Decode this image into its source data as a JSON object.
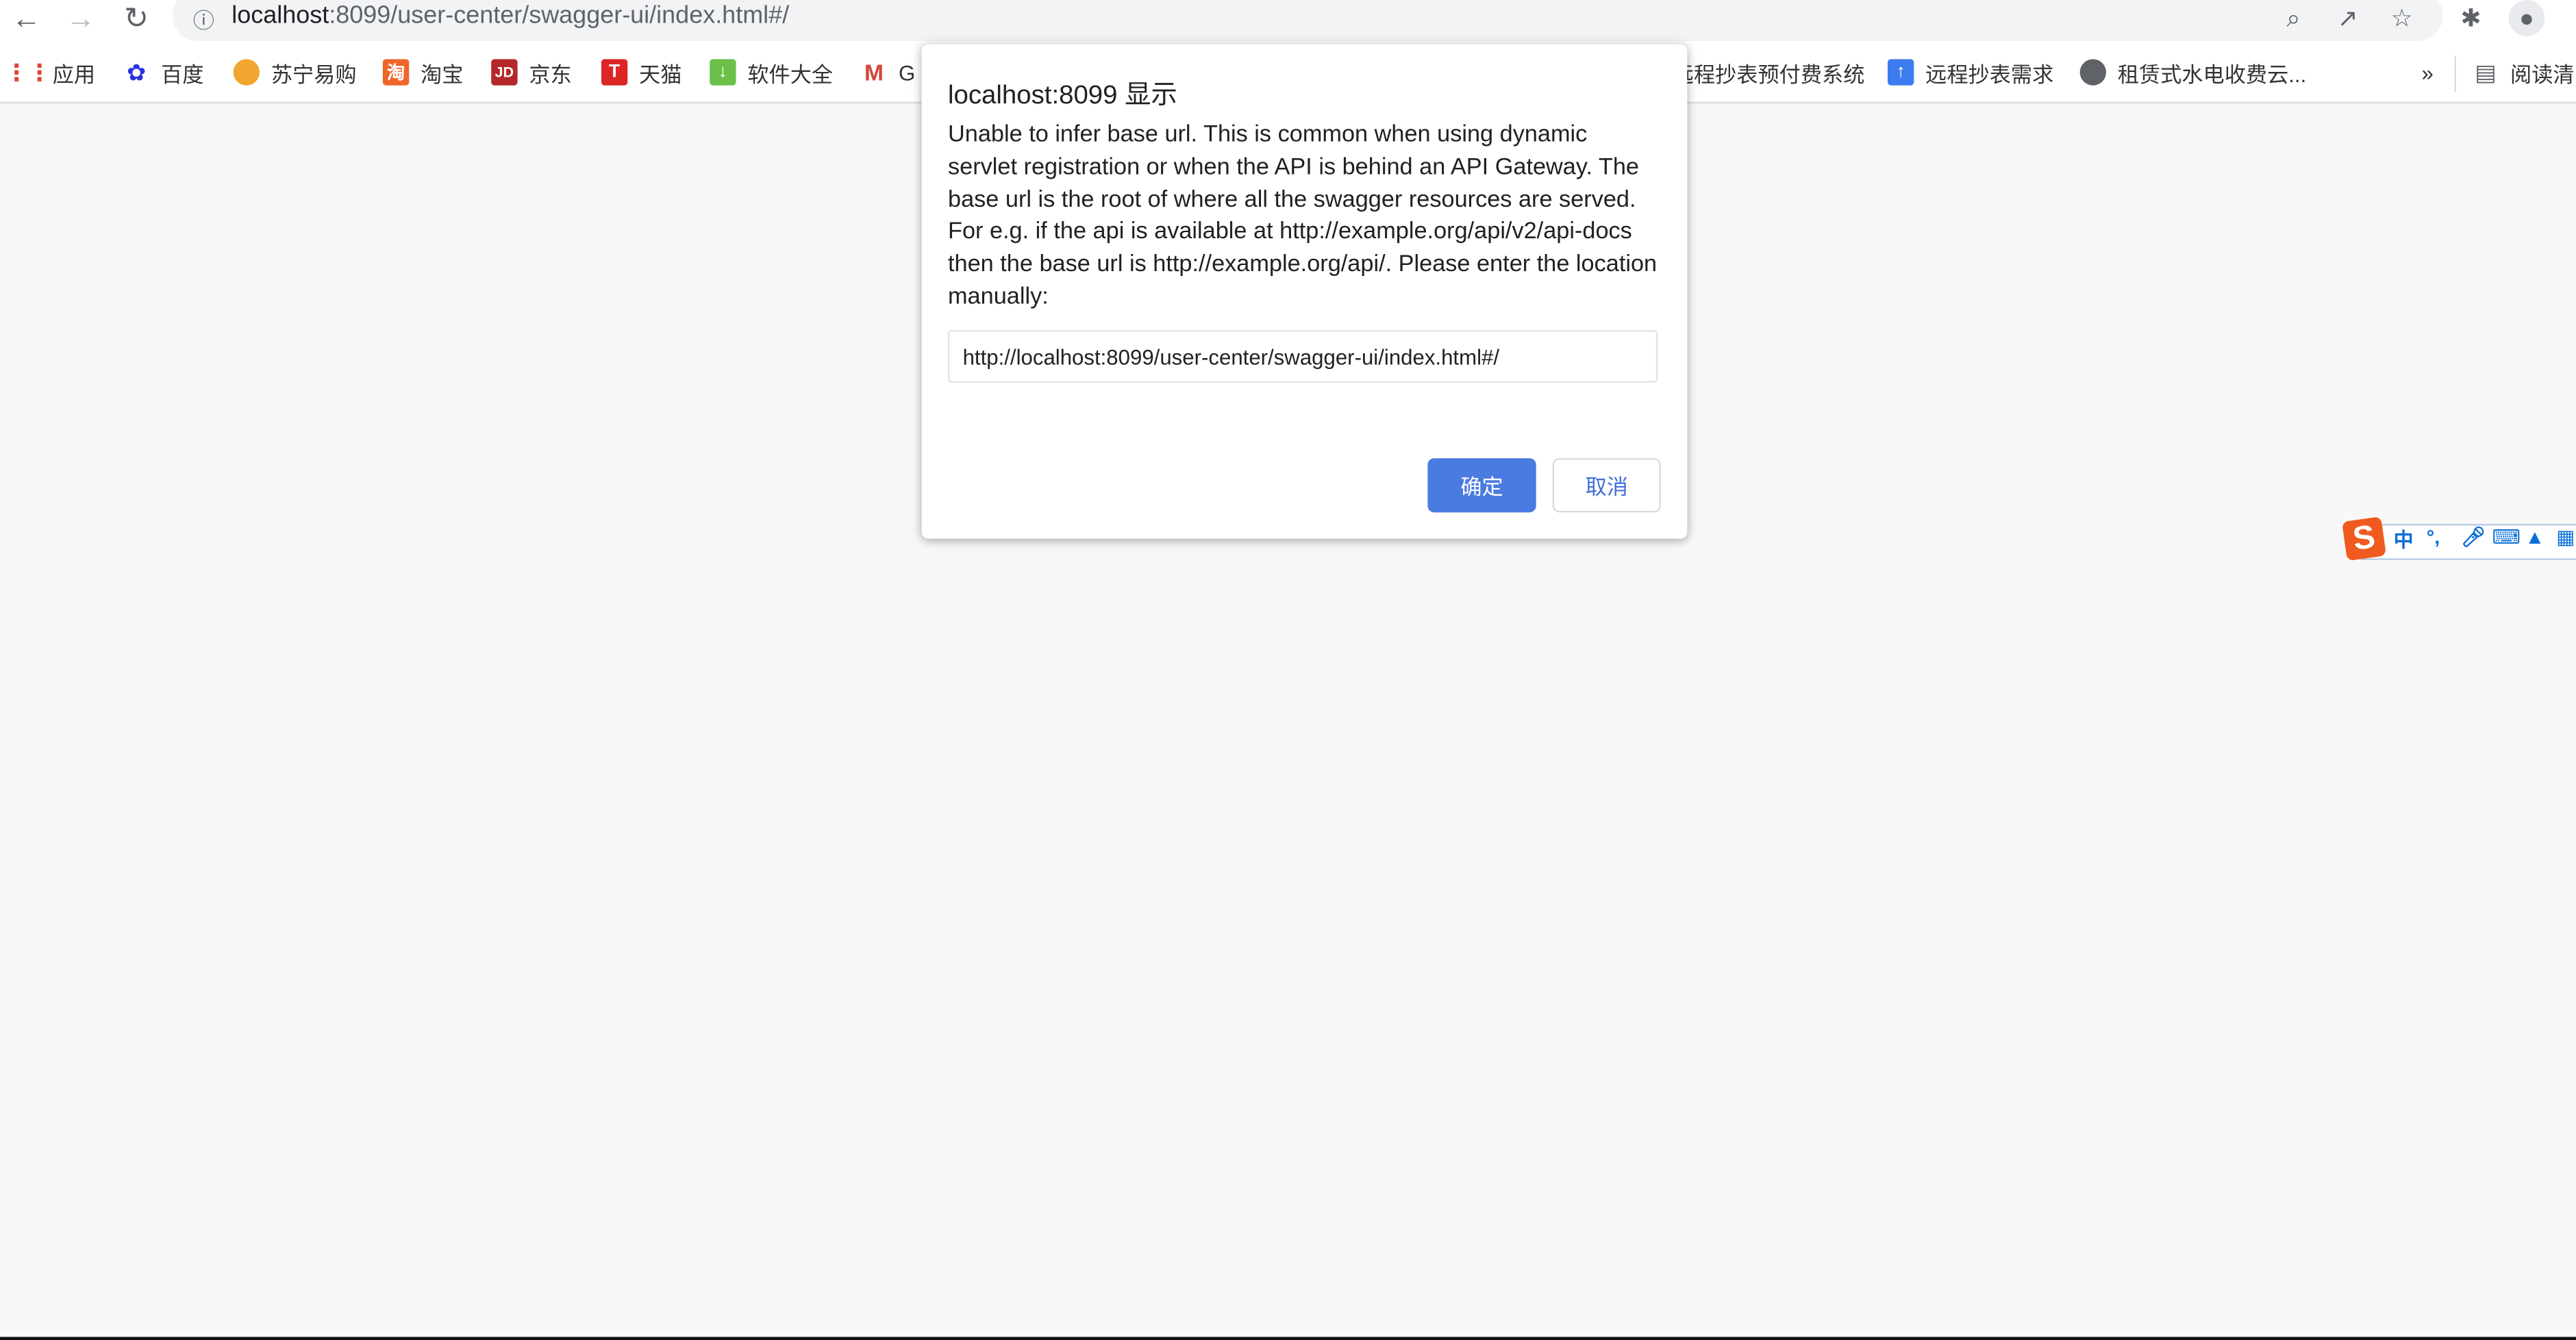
{
  "browser": {
    "url_host": "localhost",
    "url_rest": ":8099/user-center/swagger-ui/index.html#/",
    "nav": {
      "back": "arrow-left-icon",
      "forward": "arrow-right-icon",
      "reload": "reload-icon"
    },
    "right_icons": [
      "zoom-icon",
      "share-icon",
      "star-icon",
      "extensions-icon",
      "profile-icon"
    ],
    "bookmarks": [
      {
        "label": "应用",
        "icon": "apps-grid-icon",
        "color": "#e34133"
      },
      {
        "label": "百度",
        "icon": "baidu-paw-icon",
        "color": "#2932e1"
      },
      {
        "label": "苏宁易购",
        "icon": "suning-lion-icon",
        "color": "#f0a630"
      },
      {
        "label": "淘宝",
        "icon": "taobao-icon",
        "color": "#f0662a"
      },
      {
        "label": "京东",
        "icon": "jd-icon",
        "color": "#b5282a"
      },
      {
        "label": "天猫",
        "icon": "tmall-icon",
        "color": "#dd2727"
      },
      {
        "label": "软件大全",
        "icon": "download-icon",
        "color": "#6cc04a"
      },
      {
        "label": "G",
        "icon": "gmail-icon",
        "color": "#d44638"
      },
      {
        "label": "远程抄表预付费系统",
        "icon": "",
        "color": ""
      },
      {
        "label": "远程抄表需求",
        "icon": "docs-icon",
        "color": "#3d7cf0"
      },
      {
        "label": "租赁式水电收费云...",
        "icon": "globe-icon",
        "color": "#5f6368"
      }
    ],
    "more": "»",
    "reading_list": "阅读清"
  },
  "dialog": {
    "title": "localhost:8099 显示",
    "message": "Unable to infer base url. This is common when using dynamic servlet registration or when the API is behind an API Gateway. The base url is the root of where all the swagger resources are served. For e.g. if the api is available at http://example.org/api/v2/api-docs then the base url is http://example.org/api/. Please enter the location manually:",
    "input_value": "http://localhost:8099/user-center/swagger-ui/index.html#/",
    "ok_label": "确定",
    "cancel_label": "取消",
    "ok_color": "#4a7be0"
  },
  "ime": {
    "logo": "S",
    "mode": "中",
    "punct": "°,",
    "icons": [
      "microphone-icon",
      "keyboard-icon",
      "skin-shirt-icon",
      "toolbox-grid-icon"
    ]
  }
}
